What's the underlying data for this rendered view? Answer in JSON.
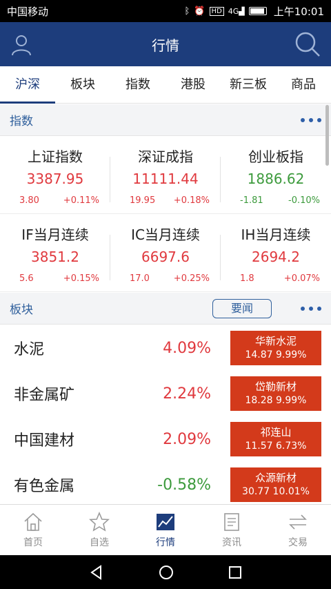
{
  "status_bar": {
    "carrier": "中国移动",
    "time": "上午10:01",
    "icons": [
      "bluetooth-icon",
      "alarm-icon",
      "hd-icon",
      "4g-signal-icon",
      "battery-icon"
    ]
  },
  "header": {
    "title": "行情",
    "left_icon": "user-icon",
    "right_icon": "search-icon"
  },
  "tabs": [
    {
      "label": "沪深",
      "active": true
    },
    {
      "label": "板块",
      "active": false
    },
    {
      "label": "指数",
      "active": false
    },
    {
      "label": "港股",
      "active": false
    },
    {
      "label": "新三板",
      "active": false
    },
    {
      "label": "商品",
      "active": false
    }
  ],
  "index_section": {
    "label": "指数",
    "items": [
      {
        "name": "上证指数",
        "value": "3387.95",
        "change": "3.80",
        "pct": "+0.11%",
        "dir": "up"
      },
      {
        "name": "深证成指",
        "value": "11111.44",
        "change": "19.95",
        "pct": "+0.18%",
        "dir": "up"
      },
      {
        "name": "创业板指",
        "value": "1886.62",
        "change": "-1.81",
        "pct": "-0.10%",
        "dir": "down"
      },
      {
        "name": "IF当月连续",
        "value": "3851.2",
        "change": "5.6",
        "pct": "+0.15%",
        "dir": "up"
      },
      {
        "name": "IC当月连续",
        "value": "6697.6",
        "change": "17.0",
        "pct": "+0.25%",
        "dir": "up"
      },
      {
        "name": "IH当月连续",
        "value": "2694.2",
        "change": "1.8",
        "pct": "+0.07%",
        "dir": "up"
      }
    ]
  },
  "sector_section": {
    "label": "板块",
    "news_button": "要闻",
    "rows": [
      {
        "name": "水泥",
        "pct": "4.09%",
        "dir": "up",
        "stock": "华新水泥",
        "stock_info": "14.87 9.99%"
      },
      {
        "name": "非金属矿",
        "pct": "2.24%",
        "dir": "up",
        "stock": "岱勒新材",
        "stock_info": "18.28 9.99%"
      },
      {
        "name": "中国建材",
        "pct": "2.09%",
        "dir": "up",
        "stock": "祁连山",
        "stock_info": "11.57 6.73%"
      },
      {
        "name": "有色金属",
        "pct": "-0.58%",
        "dir": "down",
        "stock": "众源新材",
        "stock_info": "30.77 10.01%"
      }
    ]
  },
  "bottom_nav": [
    {
      "label": "首页",
      "icon": "home-icon",
      "active": false
    },
    {
      "label": "自选",
      "icon": "star-icon",
      "active": false
    },
    {
      "label": "行情",
      "icon": "chart-icon",
      "active": true
    },
    {
      "label": "资讯",
      "icon": "news-icon",
      "active": false
    },
    {
      "label": "交易",
      "icon": "trade-icon",
      "active": false
    }
  ],
  "colors": {
    "primary": "#1d3d7c",
    "up": "#e0393e",
    "down": "#3c9a3c",
    "stock_box": "#d33a1b"
  }
}
